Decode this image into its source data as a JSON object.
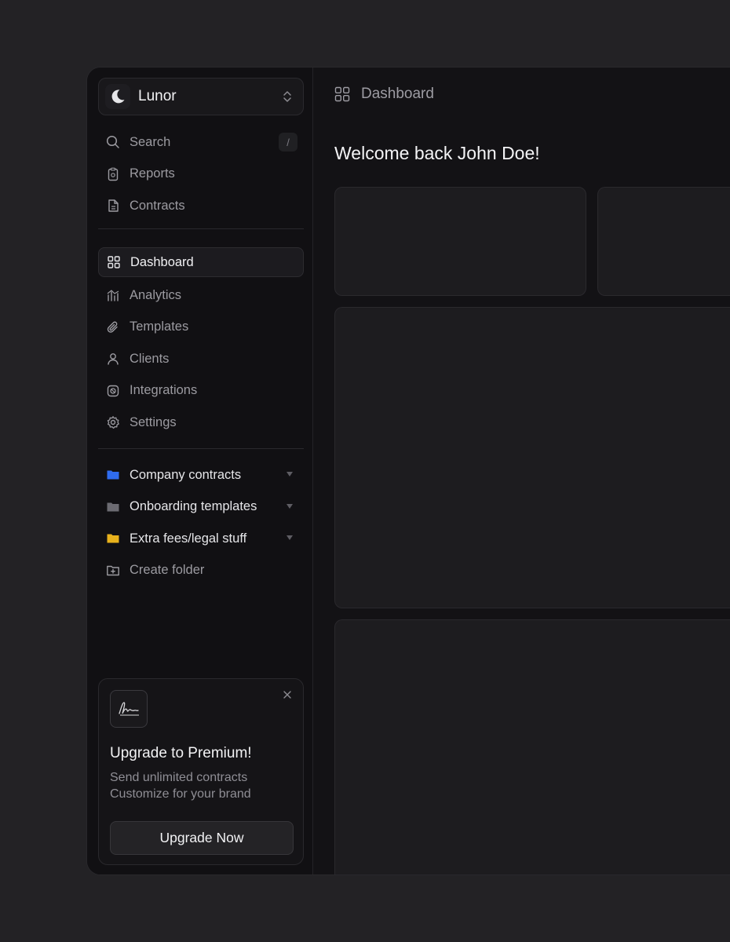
{
  "workspace": {
    "name": "Lunor"
  },
  "sidebar": {
    "search": {
      "label": "Search",
      "shortcut": "/"
    },
    "top_items": [
      {
        "label": "Reports",
        "icon": "report-icon"
      },
      {
        "label": "Contracts",
        "icon": "document-icon"
      }
    ],
    "main_items": [
      {
        "label": "Dashboard",
        "icon": "grid-icon",
        "active": true
      },
      {
        "label": "Analytics",
        "icon": "analytics-icon"
      },
      {
        "label": "Templates",
        "icon": "paperclip-icon"
      },
      {
        "label": "Clients",
        "icon": "user-icon"
      },
      {
        "label": "Integrations",
        "icon": "integrations-icon"
      },
      {
        "label": "Settings",
        "icon": "gear-icon"
      }
    ],
    "folders": [
      {
        "label": "Company contracts",
        "color": "#2f6cf0"
      },
      {
        "label": "Onboarding templates",
        "color": "#6c6b72"
      },
      {
        "label": "Extra fees/legal stuff",
        "color": "#e8b11c"
      }
    ],
    "create_folder": "Create folder"
  },
  "promo": {
    "title": "Upgrade to Premium!",
    "line1": "Send unlimited contracts",
    "line2": "Customize for your brand",
    "button": "Upgrade Now"
  },
  "main": {
    "breadcrumb": "Dashboard",
    "welcome": "Welcome back John Doe!"
  }
}
